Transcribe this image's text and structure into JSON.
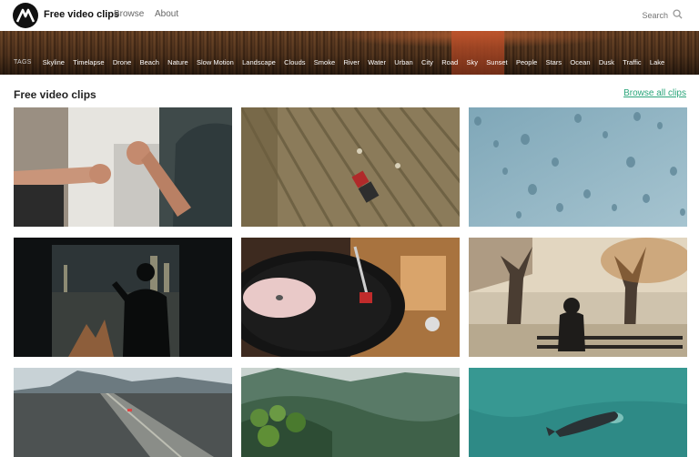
{
  "header": {
    "brand": "Free video clips",
    "nav": [
      {
        "label": "Browse"
      },
      {
        "label": "About"
      }
    ],
    "search_placeholder": "Search"
  },
  "tags": {
    "label": "TAGS",
    "items": [
      "Skyline",
      "Timelapse",
      "Drone",
      "Beach",
      "Nature",
      "Slow Motion",
      "Landscape",
      "Clouds",
      "Smoke",
      "River",
      "Water",
      "Urban",
      "City",
      "Road",
      "Sky",
      "Sunset",
      "People",
      "Stars",
      "Ocean",
      "Dusk",
      "Traffic",
      "Lake"
    ]
  },
  "section": {
    "title": "Free video clips",
    "browse_all": "Browse all clips"
  },
  "clips": [
    {
      "subject": "fist-bump"
    },
    {
      "subject": "tractor-field"
    },
    {
      "subject": "raindrops-glass"
    },
    {
      "subject": "person-window-city"
    },
    {
      "subject": "record-player"
    },
    {
      "subject": "person-bench-park"
    },
    {
      "subject": "mountain-road"
    },
    {
      "subject": "forest-hills"
    },
    {
      "subject": "whale-ocean"
    }
  ],
  "colors": {
    "accent": "#2aa57a",
    "header_bg": "#ffffff",
    "text": "#222222"
  }
}
